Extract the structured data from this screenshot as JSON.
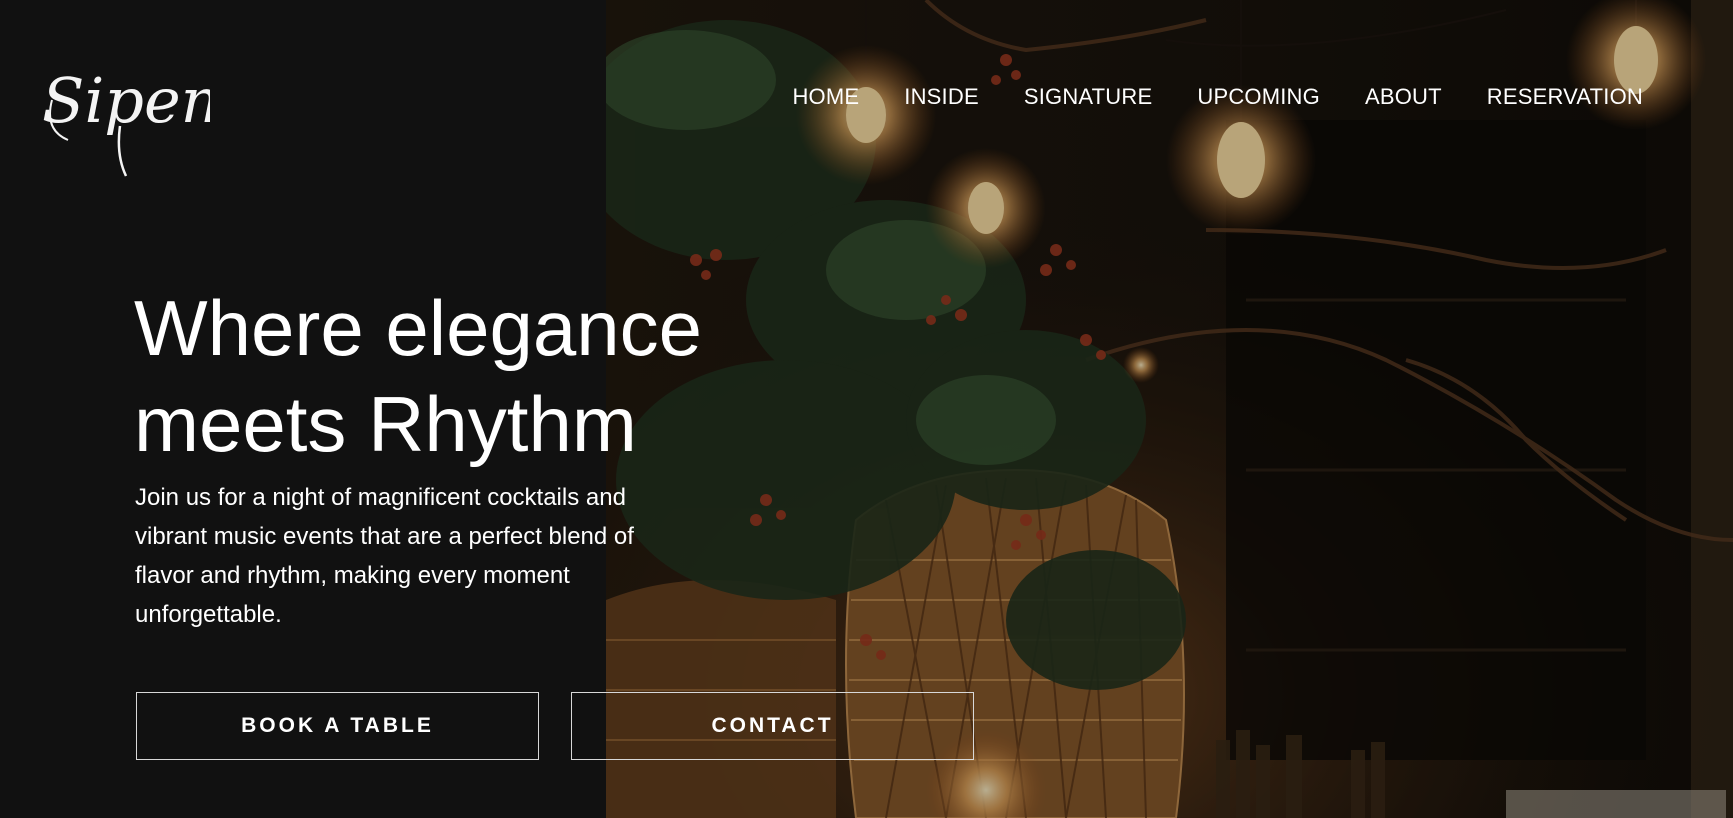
{
  "brand": {
    "logo_text": "Sipem"
  },
  "nav": {
    "items": [
      {
        "label": "HOME"
      },
      {
        "label": "INSIDE"
      },
      {
        "label": "SIGNATURE"
      },
      {
        "label": "UPCOMING"
      },
      {
        "label": "ABOUT"
      },
      {
        "label": "RESERVATION"
      }
    ]
  },
  "hero": {
    "headline_line1": "Where elegance",
    "headline_line2": "meets Rhythm",
    "description": "Join us for a night of magnificent cocktails and vibrant music events that are a perfect blend of flavor and rhythm, making every moment unforgettable.",
    "book_label": "BOOK A TABLE",
    "contact_label": "CONTACT"
  },
  "colors": {
    "background": "#111111",
    "text": "#ffffff",
    "button_border": "#d8d8d8"
  }
}
